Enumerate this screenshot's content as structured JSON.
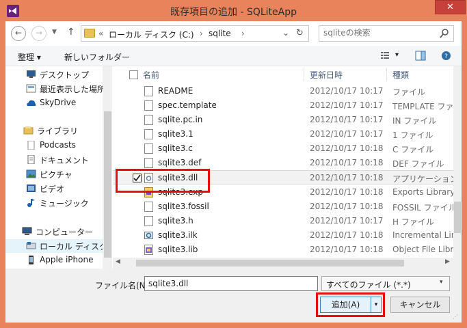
{
  "window": {
    "title": "既存項目の追加 - SQLiteApp",
    "close_label": "✕"
  },
  "address": {
    "back_icon": "←",
    "forward_icon": "→",
    "up_icon": "↑",
    "overflow": "«",
    "crumbs": [
      "ローカル ディスク (C:)",
      "sqlite"
    ],
    "separator": "›",
    "dropdown_icon": "⌄",
    "refresh_icon": "↻",
    "search_placeholder": "sqliteの検索"
  },
  "toolbar": {
    "organize_label": "整理 ▾",
    "new_folder_label": "新しいフォルダー",
    "view_dropdown": "▾"
  },
  "nav": {
    "items": [
      {
        "label": "デスクトップ",
        "icon": "desktop-icon"
      },
      {
        "label": "最近表示した場所",
        "icon": "recent-places-icon"
      },
      {
        "label": "SkyDrive",
        "icon": "skydrive-icon"
      },
      {
        "label": "ライブラリ",
        "icon": "libraries-icon"
      },
      {
        "label": "Podcasts",
        "icon": "document-icon"
      },
      {
        "label": "ドキュメント",
        "icon": "documents-icon"
      },
      {
        "label": "ピクチャ",
        "icon": "pictures-icon"
      },
      {
        "label": "ビデオ",
        "icon": "video-icon"
      },
      {
        "label": "ミュージック",
        "icon": "music-icon"
      },
      {
        "label": "コンピューター",
        "icon": "computer-icon"
      },
      {
        "label": "ローカル ディスク (C",
        "icon": "drive-icon"
      },
      {
        "label": "Apple iPhone",
        "icon": "phone-icon"
      }
    ]
  },
  "columns": {
    "name": "名前",
    "date": "更新日時",
    "type": "種類"
  },
  "files": [
    {
      "name": "README",
      "date": "2012/10/17 10:17",
      "type": "ファイル",
      "icon": "file-icon"
    },
    {
      "name": "spec.template",
      "date": "2012/10/17 10:17",
      "type": "TEMPLATE ファイル",
      "icon": "file-icon"
    },
    {
      "name": "sqlite.pc.in",
      "date": "2012/10/17 10:17",
      "type": "IN ファイル",
      "icon": "file-icon"
    },
    {
      "name": "sqlite3.1",
      "date": "2012/10/17 10:17",
      "type": "1 ファイル",
      "icon": "file-icon"
    },
    {
      "name": "sqlite3.c",
      "date": "2012/10/17 10:18",
      "type": "C ファイル",
      "icon": "c-file-icon"
    },
    {
      "name": "sqlite3.def",
      "date": "2012/10/17 10:18",
      "type": "DEF ファイル",
      "icon": "file-icon"
    },
    {
      "name": "sqlite3.dll",
      "date": "2012/10/17 10:18",
      "type": "アプリケーション拡張",
      "icon": "dll-icon"
    },
    {
      "name": "sqlite3.exp",
      "date": "2012/10/17 10:18",
      "type": "Exports Library",
      "icon": "exp-icon"
    },
    {
      "name": "sqlite3.fossil",
      "date": "2012/10/17 10:18",
      "type": "FOSSIL ファイル",
      "icon": "file-icon"
    },
    {
      "name": "sqlite3.h",
      "date": "2012/10/17 10:17",
      "type": "H ファイル",
      "icon": "h-file-icon"
    },
    {
      "name": "sqlite3.ilk",
      "date": "2012/10/17 10:18",
      "type": "Incremental Lin",
      "icon": "ilk-icon"
    },
    {
      "name": "sqlite3.lib",
      "date": "2012/10/17 10:18",
      "type": "Object File Libr.",
      "icon": "lib-icon"
    }
  ],
  "footer": {
    "filename_label": "ファイル名(N):",
    "filename_value": "sqlite3.dll",
    "filter_value": "すべてのファイル (*.*)",
    "filter_dropdown": "▾",
    "add_label": "追加(A)",
    "add_split": "▾",
    "cancel_label": "キャンセル"
  },
  "colors": {
    "frame": "#e9835b",
    "highlight": "#e60f0f",
    "selection": "#f2f2f2"
  }
}
